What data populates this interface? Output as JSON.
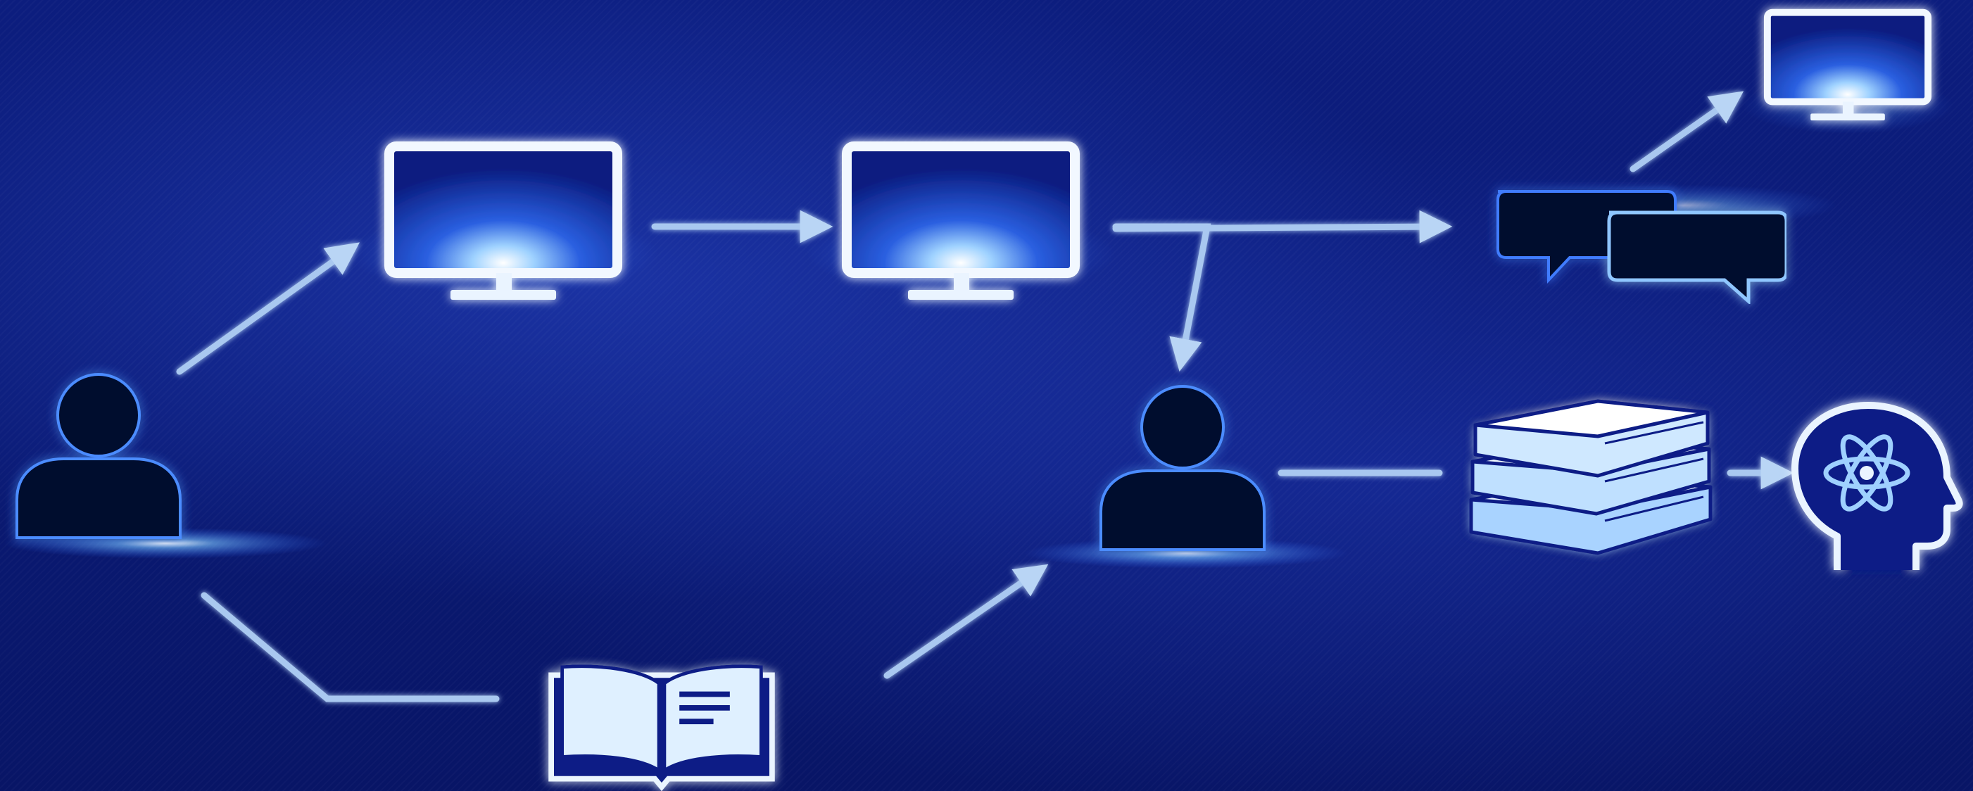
{
  "diagram": {
    "nodes": [
      {
        "id": "person-left",
        "icon": "person-icon"
      },
      {
        "id": "monitor-1",
        "icon": "monitor-icon"
      },
      {
        "id": "monitor-2",
        "icon": "monitor-icon"
      },
      {
        "id": "chat",
        "icon": "chat-bubbles-icon"
      },
      {
        "id": "monitor-3",
        "icon": "monitor-icon"
      },
      {
        "id": "person-center",
        "icon": "person-icon"
      },
      {
        "id": "book-open",
        "icon": "open-book-icon"
      },
      {
        "id": "book-stack",
        "icon": "book-stack-icon"
      },
      {
        "id": "brain-head",
        "icon": "head-atom-icon"
      }
    ],
    "edges": [
      {
        "from": "person-left",
        "to": "monitor-1",
        "arrow": true
      },
      {
        "from": "monitor-1",
        "to": "monitor-2",
        "arrow": true
      },
      {
        "from": "monitor-2",
        "to": "chat",
        "arrow": true
      },
      {
        "from": "monitor-2",
        "to": "person-center",
        "arrow": true
      },
      {
        "from": "chat",
        "to": "monitor-3",
        "arrow": true
      },
      {
        "from": "person-left",
        "to": "book-open",
        "arrow": false
      },
      {
        "from": "book-open",
        "to": "person-center",
        "arrow": true
      },
      {
        "from": "person-center",
        "to": "book-stack",
        "arrow": false
      },
      {
        "from": "book-stack",
        "to": "brain-head",
        "arrow": true
      }
    ]
  },
  "colors": {
    "background": "#0a1a78",
    "line": "#a9c8f0",
    "glow": "#6fb6ff",
    "icon_fill": "#020a2e",
    "icon_light": "#e8f3ff",
    "screen": "#0b1f86"
  }
}
